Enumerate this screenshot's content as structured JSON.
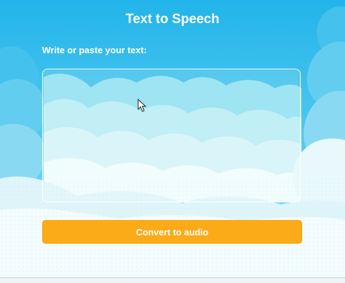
{
  "page": {
    "title": "Text to Speech",
    "textarea_label": "Write or paste your text:",
    "textarea_value": "",
    "textarea_placeholder": "",
    "convert_label": "Convert to audio"
  },
  "colors": {
    "sky": "#2bb8ec",
    "button": "#fbab17",
    "text": "#ffffff"
  },
  "icons": {
    "cursor": "mouse-pointer-icon"
  }
}
